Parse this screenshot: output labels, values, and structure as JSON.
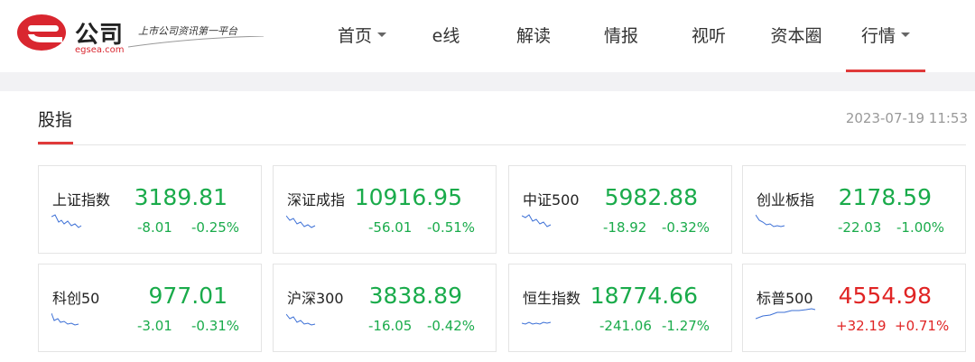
{
  "brand": {
    "name": "公司",
    "slogan": "上市公司资讯第一平台",
    "url": "egsea.com",
    "colors": {
      "primary": "#d9262f",
      "accent_line": "#e03a3a"
    }
  },
  "nav": {
    "items": [
      {
        "label": "首页",
        "has_dropdown": true
      },
      {
        "label": "e线",
        "has_dropdown": false
      },
      {
        "label": "解读",
        "has_dropdown": false
      },
      {
        "label": "情报",
        "has_dropdown": false
      },
      {
        "label": "视听",
        "has_dropdown": false
      },
      {
        "label": "资本圈",
        "has_dropdown": false
      },
      {
        "label": "行情",
        "has_dropdown": true,
        "active": true
      }
    ]
  },
  "section": {
    "title": "股指",
    "timestamp": "2023-07-19 11:53"
  },
  "status_colors": {
    "up": "#e02424",
    "down": "#1aab4b"
  },
  "indices": [
    {
      "name": "上证指数",
      "price": "3189.81",
      "change": "-8.01",
      "change_pct": "-0.25%",
      "direction": "down"
    },
    {
      "name": "深证成指",
      "price": "10916.95",
      "change": "-56.01",
      "change_pct": "-0.51%",
      "direction": "down"
    },
    {
      "name": "中证500",
      "price": "5982.88",
      "change": "-18.92",
      "change_pct": "-0.32%",
      "direction": "down"
    },
    {
      "name": "创业板指",
      "price": "2178.59",
      "change": "-22.03",
      "change_pct": "-1.00%",
      "direction": "down"
    },
    {
      "name": "科创50",
      "price": "977.01",
      "change": "-3.01",
      "change_pct": "-0.31%",
      "direction": "down"
    },
    {
      "name": "沪深300",
      "price": "3838.89",
      "change": "-16.05",
      "change_pct": "-0.42%",
      "direction": "down"
    },
    {
      "name": "恒生指数",
      "price": "18774.66",
      "change": "-241.06",
      "change_pct": "-1.27%",
      "direction": "down"
    },
    {
      "name": "标普500",
      "price": "4554.98",
      "change": "+32.19",
      "change_pct": "+0.71%",
      "direction": "up"
    }
  ]
}
